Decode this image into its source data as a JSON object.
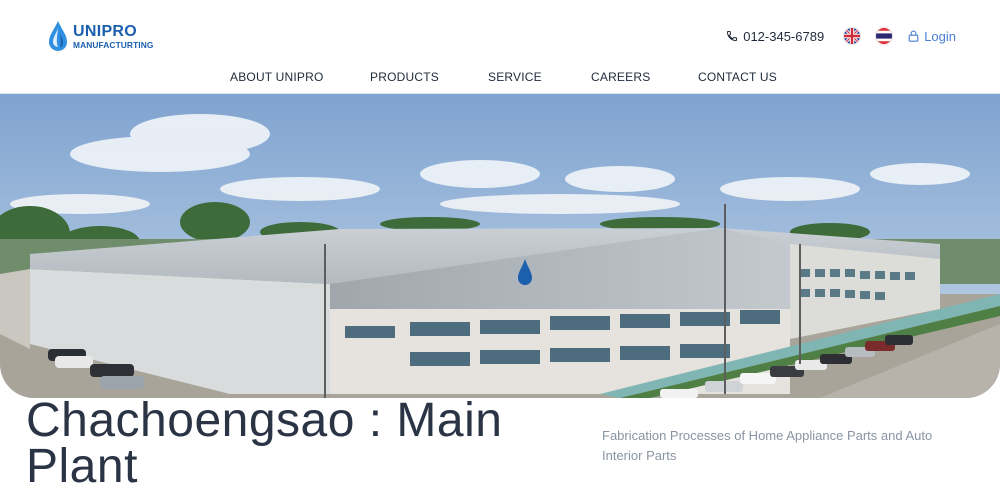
{
  "brand": {
    "name": "UNIPRO",
    "tagline": "MANUFACTURTING",
    "color": "#1b5fae"
  },
  "header": {
    "phone": "012-345-6789",
    "languages": [
      "english-flag",
      "thai-flag"
    ],
    "login_label": "Login",
    "login_color": "#4a7fd4"
  },
  "nav": {
    "items": [
      {
        "label": "ABOUT UNIPRO"
      },
      {
        "label": "PRODUCTS"
      },
      {
        "label": "SERVICE"
      },
      {
        "label": "CAREERS"
      },
      {
        "label": "CONTACT US"
      }
    ]
  },
  "hero": {
    "image": "aerial-factory-photo"
  },
  "location": {
    "title": "Chachoengsao : Main Plant",
    "description": "Fabrication Processes of Home Appliance Parts and Auto Interior Parts"
  }
}
